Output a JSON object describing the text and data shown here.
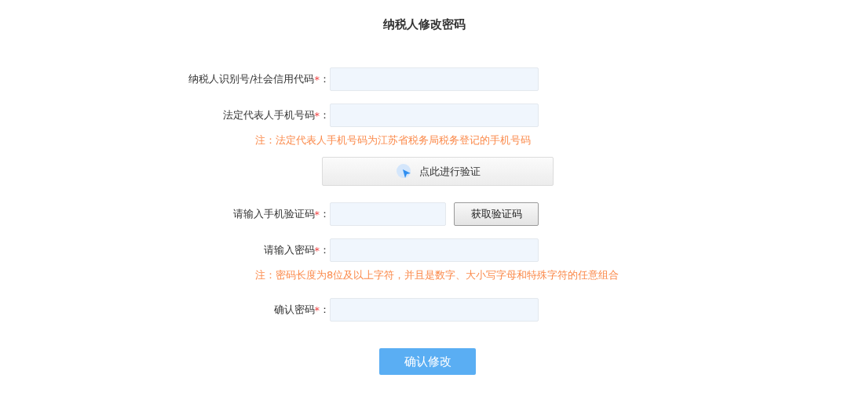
{
  "title": "纳税人修改密码",
  "rows": [
    {
      "kind": "field",
      "label": "纳税人识别号/社会信用代码",
      "mark": "*",
      "colon": "："
    },
    {
      "kind": "field",
      "label": "法定代表人手机号码",
      "mark": "*",
      "colon": "："
    },
    {
      "kind": "note",
      "text": "注：法定代表人手机号码为江苏省税务局税务登记的手机号码"
    },
    {
      "kind": "verify",
      "text": "点此进行验证"
    },
    {
      "kind": "code",
      "label": "请输入手机验证码",
      "mark": "*",
      "colon": "：",
      "button": "获取验证码"
    },
    {
      "kind": "password",
      "label": "请输入密码",
      "mark": "*",
      "colon": "："
    },
    {
      "kind": "note",
      "text": "注：密码长度为8位及以上字符，并且是数字、大小写字母和特殊字符的任意组合"
    },
    {
      "kind": "password",
      "label": "确认密码",
      "mark": "*",
      "colon": "："
    }
  ],
  "submit": "确认修改"
}
